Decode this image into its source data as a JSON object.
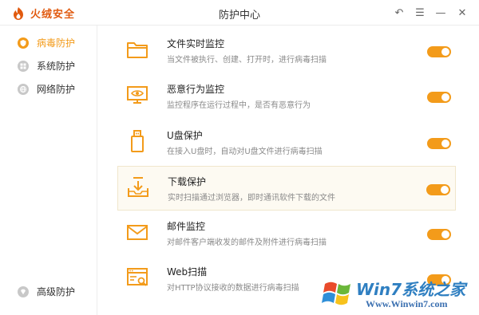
{
  "app": {
    "brand": "火绒安全",
    "window_title": "防护中心"
  },
  "colors": {
    "accent": "#f39b1a",
    "brand": "#e15a0f"
  },
  "window_controls": [
    {
      "name": "undo-icon",
      "glyph": "↶"
    },
    {
      "name": "menu-icon",
      "glyph": "☰"
    },
    {
      "name": "minimize-icon",
      "glyph": "—"
    },
    {
      "name": "close-icon",
      "glyph": "✕"
    }
  ],
  "sidebar": {
    "items": [
      {
        "label": "病毒防护",
        "icon": "shield-icon",
        "active": true
      },
      {
        "label": "系统防护",
        "icon": "system-icon",
        "active": false
      },
      {
        "label": "网络防护",
        "icon": "globe-icon",
        "active": false
      }
    ],
    "bottom_item": {
      "label": "高级防护",
      "icon": "diamond-icon"
    }
  },
  "features": [
    {
      "title": "文件实时监控",
      "desc": "当文件被执行、创建、打开时，进行病毒扫描",
      "icon": "folder-icon",
      "enabled": true
    },
    {
      "title": "恶意行为监控",
      "desc": "监控程序在运行过程中，是否有恶意行为",
      "icon": "monitor-eye-icon",
      "enabled": true
    },
    {
      "title": "U盘保护",
      "desc": "在接入U盘时，自动对U盘文件进行病毒扫描",
      "icon": "usb-icon",
      "enabled": true
    },
    {
      "title": "下载保护",
      "desc": "实时扫描通过浏览器，即时通讯软件下载的文件",
      "icon": "download-icon",
      "enabled": true
    },
    {
      "title": "邮件监控",
      "desc": "对邮件客户端收发的邮件及附件进行病毒扫描",
      "icon": "mail-icon",
      "enabled": true
    },
    {
      "title": "Web扫描",
      "desc": "对HTTP协议接收的数据进行病毒扫描",
      "icon": "web-scan-icon",
      "enabled": true
    }
  ],
  "watermark": {
    "line1": "Win7系统之家",
    "line2": "Www.Winwin7.com"
  }
}
